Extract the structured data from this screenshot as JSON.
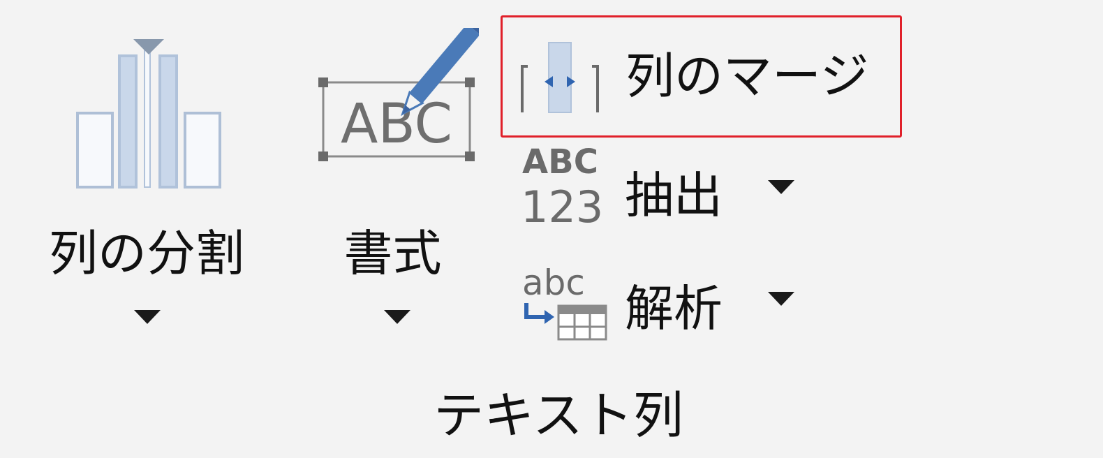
{
  "group": {
    "label": "テキスト列"
  },
  "buttons": {
    "split_column": {
      "label": "列の分割",
      "icon": "split-column-icon"
    },
    "format": {
      "label": "書式",
      "icon": "format-abc-icon",
      "icon_text": "ABC"
    },
    "merge_columns": {
      "label": "列のマージ",
      "icon": "merge-columns-icon",
      "highlighted": true
    },
    "extract": {
      "label": "抽出",
      "icon": "extract-abc123-icon",
      "icon_text_top": "ABC",
      "icon_text_bottom": "123"
    },
    "parse": {
      "label": "解析",
      "icon": "parse-abc-icon",
      "icon_text": "abc"
    }
  },
  "colors": {
    "highlight": "#e0202a",
    "icon_blue": "#4a7ab8",
    "icon_light_blue": "#c9d7ea",
    "icon_gray": "#6e6e6e"
  }
}
